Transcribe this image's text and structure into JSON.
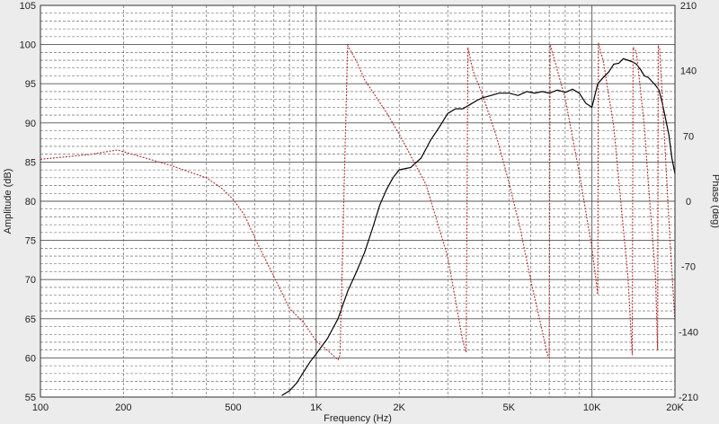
{
  "chart_data": {
    "type": "line",
    "title": "",
    "xlabel": "Frequency (Hz)",
    "ylabel": "Amplitude (dB)",
    "y2label": "Phase (deg)",
    "xscale": "log",
    "xlim": [
      100,
      20000
    ],
    "ylim": [
      55,
      105
    ],
    "y2lim": [
      -210,
      210
    ],
    "grid": true,
    "colors": {
      "amplitude": "#000000",
      "phase": "#b03030",
      "grid": "#555555",
      "background": "#ffffff"
    },
    "x_ticks": [
      {
        "value": 100,
        "label": "100"
      },
      {
        "value": 200,
        "label": "200"
      },
      {
        "value": 500,
        "label": "500"
      },
      {
        "value": 1000,
        "label": "1K"
      },
      {
        "value": 2000,
        "label": "2K"
      },
      {
        "value": 5000,
        "label": "5K"
      },
      {
        "value": 10000,
        "label": "10K"
      },
      {
        "value": 20000,
        "label": "20K"
      }
    ],
    "y_ticks": [
      {
        "value": 55,
        "label": "55"
      },
      {
        "value": 60,
        "label": "60"
      },
      {
        "value": 65,
        "label": "65"
      },
      {
        "value": 70,
        "label": "70"
      },
      {
        "value": 75,
        "label": "75"
      },
      {
        "value": 80,
        "label": "80"
      },
      {
        "value": 85,
        "label": "85"
      },
      {
        "value": 90,
        "label": "90"
      },
      {
        "value": 95,
        "label": "95"
      },
      {
        "value": 100,
        "label": "100"
      },
      {
        "value": 105,
        "label": "105"
      }
    ],
    "y2_ticks": [
      {
        "value": 210,
        "label": "210"
      },
      {
        "value": 140,
        "label": "140"
      },
      {
        "value": 70,
        "label": "70"
      },
      {
        "value": 0,
        "label": "0"
      },
      {
        "value": -70,
        "label": "-70"
      },
      {
        "value": -140,
        "label": "-140"
      },
      {
        "value": -210,
        "label": "-210"
      }
    ],
    "series": [
      {
        "key": "amplitude",
        "axis": "left",
        "style": "solid",
        "x": [
          750,
          800,
          850,
          900,
          950,
          1000,
          1100,
          1200,
          1300,
          1400,
          1500,
          1600,
          1700,
          1800,
          1900,
          2000,
          2200,
          2400,
          2600,
          2800,
          3000,
          3200,
          3400,
          3600,
          3800,
          4000,
          4300,
          4600,
          5000,
          5400,
          5800,
          6200,
          6600,
          7000,
          7500,
          8000,
          8500,
          9000,
          9500,
          10000,
          10500,
          11000,
          11500,
          12000,
          12500,
          13000,
          13500,
          14000,
          14500,
          15000,
          15500,
          16000,
          16500,
          17000,
          17500,
          18000,
          18500,
          19000,
          19500,
          20000
        ],
        "y": [
          55.2,
          55.8,
          56.8,
          58.2,
          59.5,
          60.5,
          62.5,
          65.0,
          68.5,
          71.0,
          73.5,
          76.5,
          79.5,
          81.5,
          83.0,
          84.0,
          84.3,
          85.5,
          87.8,
          89.5,
          91.2,
          91.8,
          91.8,
          92.3,
          92.8,
          93.2,
          93.5,
          93.8,
          93.8,
          93.5,
          94.0,
          93.8,
          94.0,
          93.8,
          94.2,
          93.9,
          94.3,
          93.8,
          92.5,
          92.0,
          95.0,
          95.8,
          96.5,
          97.5,
          97.6,
          98.2,
          98.0,
          97.8,
          97.5,
          96.8,
          96.0,
          95.8,
          95.3,
          94.8,
          94.2,
          92.5,
          90.5,
          88.5,
          85.5,
          83.5
        ]
      },
      {
        "key": "phase",
        "axis": "right",
        "style": "dashed",
        "x": [
          100,
          150,
          190,
          230,
          300,
          400,
          450,
          500,
          550,
          600,
          700,
          800,
          900,
          1000,
          1100,
          1200,
          1220,
          1300,
          1400,
          1500,
          1800,
          2000,
          2500,
          3000,
          3400,
          3500,
          3550,
          3700,
          4000,
          4500,
          5000,
          5500,
          6000,
          6500,
          6900,
          7000,
          7050,
          7500,
          8000,
          9000,
          10000,
          10500,
          10550,
          11000,
          12000,
          13000,
          13500,
          14000,
          14100,
          14500,
          15500,
          16000,
          17000,
          17300,
          17400,
          17600,
          18000,
          19000,
          20000
        ],
        "y": [
          45,
          50,
          55,
          48,
          38,
          25,
          15,
          2,
          -15,
          -40,
          -80,
          -115,
          -130,
          -150,
          -160,
          -170,
          -165,
          167,
          150,
          130,
          95,
          72,
          18,
          -60,
          -150,
          -162,
          165,
          140,
          115,
          70,
          20,
          -30,
          -85,
          -130,
          -165,
          -168,
          168,
          140,
          110,
          30,
          -50,
          -100,
          170,
          150,
          80,
          -30,
          -80,
          -165,
          165,
          160,
          80,
          20,
          -80,
          -160,
          167,
          163,
          110,
          -20,
          -130
        ]
      }
    ]
  }
}
